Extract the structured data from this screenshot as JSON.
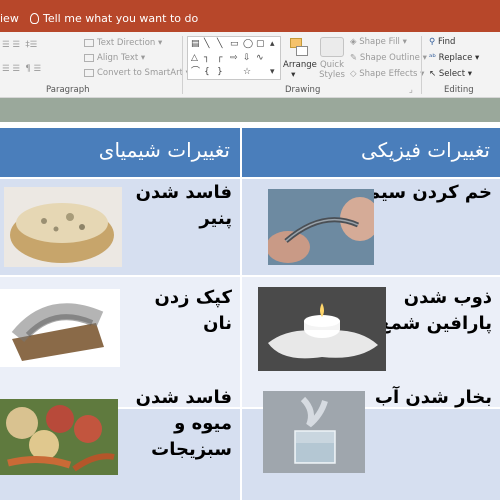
{
  "titlebar": {
    "view_label": "iew",
    "tellme_text": "Tell me what you want to do"
  },
  "ribbon": {
    "paragraph": {
      "text_direction": "Text Direction",
      "align_text": "Align Text",
      "convert_smartart": "Convert to SmartArt",
      "group_label": "Paragraph"
    },
    "drawing": {
      "arrange": "Arrange",
      "quick_styles": "Quick Styles",
      "shape_fill": "Shape Fill",
      "shape_outline": "Shape Outline",
      "shape_effects": "Shape Effects",
      "group_label": "Drawing"
    },
    "editing": {
      "find": "Find",
      "replace": "Replace",
      "select": "Select",
      "group_label": "Editing"
    }
  },
  "table": {
    "header_physical": "تغییرات فیزیکی",
    "header_chemical": "تغییرات شیمیای",
    "rows": [
      {
        "physical": "خم کردن سیم",
        "chemical_line1": "فاسد شدن",
        "chemical_line2": "پنیر"
      },
      {
        "physical_line1": "ذوب شدن",
        "physical_line2": "پارافین شمع",
        "chemical_line1": "کپک زدن",
        "chemical_line2": "نان"
      },
      {
        "physical": "بخار شدن آب",
        "chemical_line1": "فاسد شدن",
        "chemical_line2": "میوه و",
        "chemical_line3": "سبزیجات"
      }
    ]
  },
  "colors": {
    "title_bar": "#b7472a",
    "header": "#4a7ebb",
    "row_light": "#d6dff0",
    "row_lighter": "#ebeff8"
  }
}
